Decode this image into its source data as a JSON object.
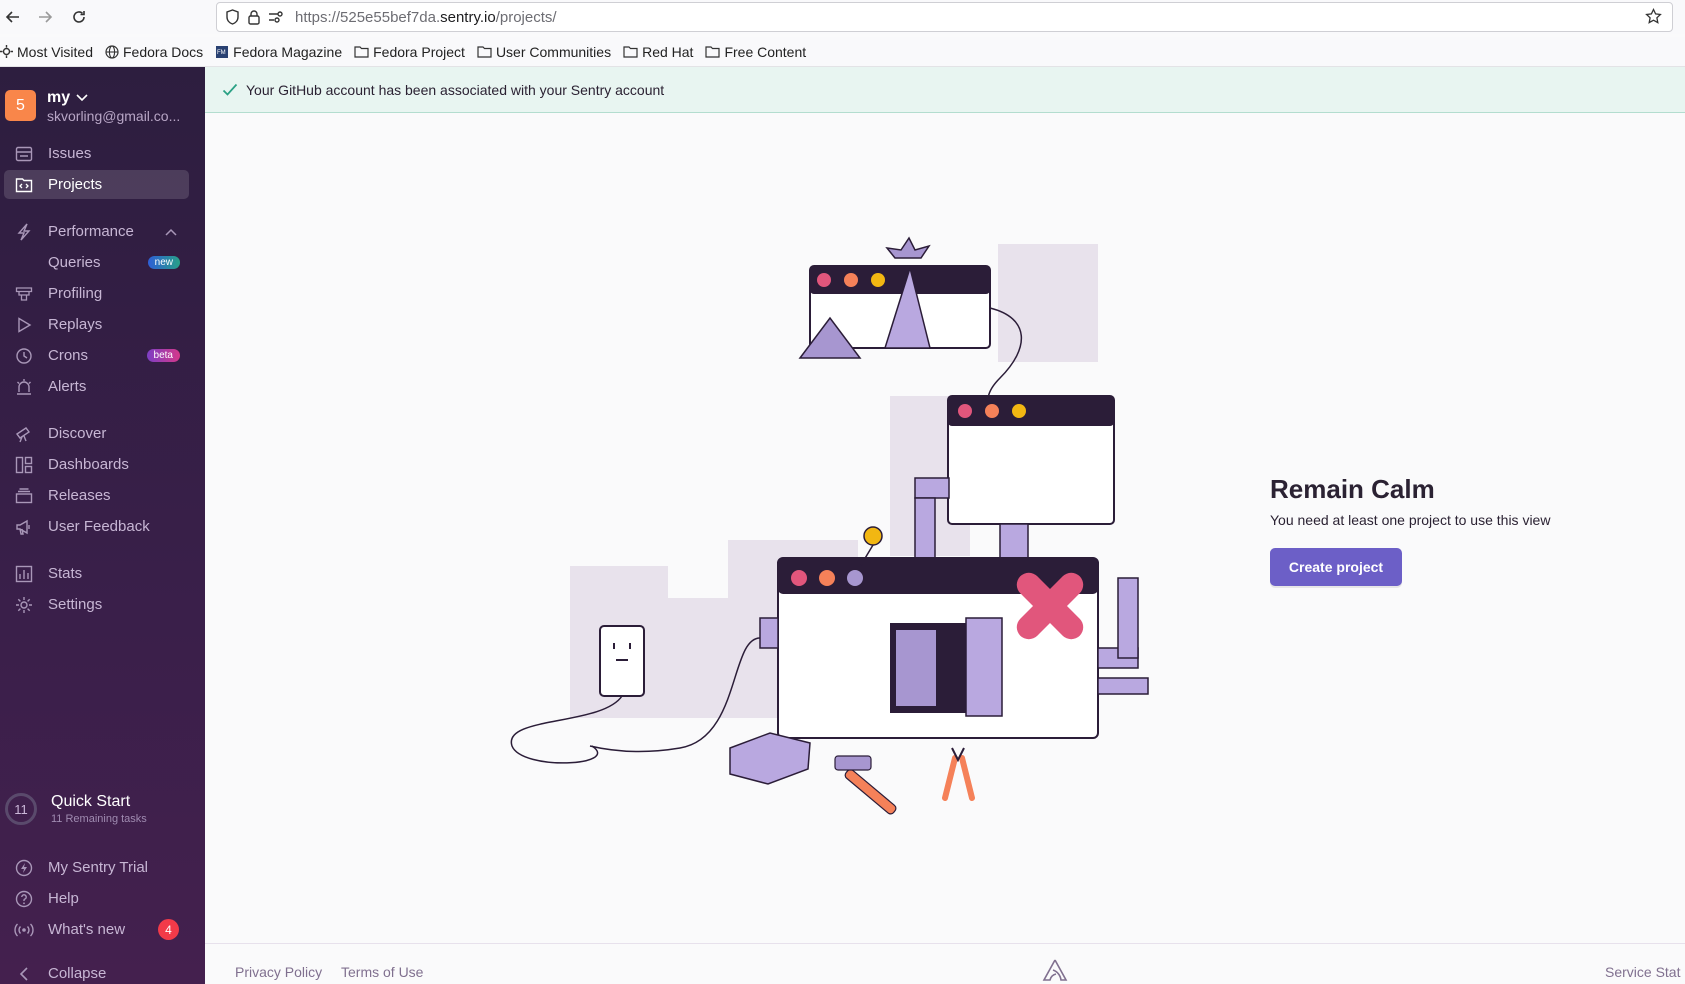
{
  "browser": {
    "url_prefix": "https://525e55bef7da.",
    "url_domain": "sentry.io",
    "url_path": "/projects/",
    "bookmarks": [
      "Most Visited",
      "Fedora Docs",
      "Fedora Magazine",
      "Fedora Project",
      "User Communities",
      "Red Hat",
      "Free Content"
    ]
  },
  "org": {
    "avatar_letter": "5",
    "name": "my",
    "email": "skvorling@gmail.co..."
  },
  "nav": {
    "issues": "Issues",
    "projects": "Projects",
    "performance": "Performance",
    "queries": "Queries",
    "queries_badge": "new",
    "profiling": "Profiling",
    "replays": "Replays",
    "crons": "Crons",
    "crons_badge": "beta",
    "alerts": "Alerts",
    "discover": "Discover",
    "dashboards": "Dashboards",
    "releases": "Releases",
    "user_feedback": "User Feedback",
    "stats": "Stats",
    "settings": "Settings"
  },
  "quickstart": {
    "count": "11",
    "title": "Quick Start",
    "subtitle": "11 Remaining tasks"
  },
  "bottom_nav": {
    "trial": "My Sentry Trial",
    "help": "Help",
    "whats_new": "What's new",
    "whats_new_count": "4",
    "collapse": "Collapse"
  },
  "alert": {
    "message": "Your GitHub account has been associated with your Sentry account"
  },
  "empty_state": {
    "title": "Remain Calm",
    "text": "You need at least one project to use this view",
    "button": "Create project"
  },
  "footer": {
    "privacy": "Privacy Policy",
    "terms": "Terms of Use",
    "status": "Service Stat"
  },
  "colors": {
    "accent": "#6c5fc7",
    "sidebar": "#2d1e3f",
    "alert_bg": "#e8f5f1",
    "success": "#2ba185",
    "danger": "#f23a49"
  }
}
